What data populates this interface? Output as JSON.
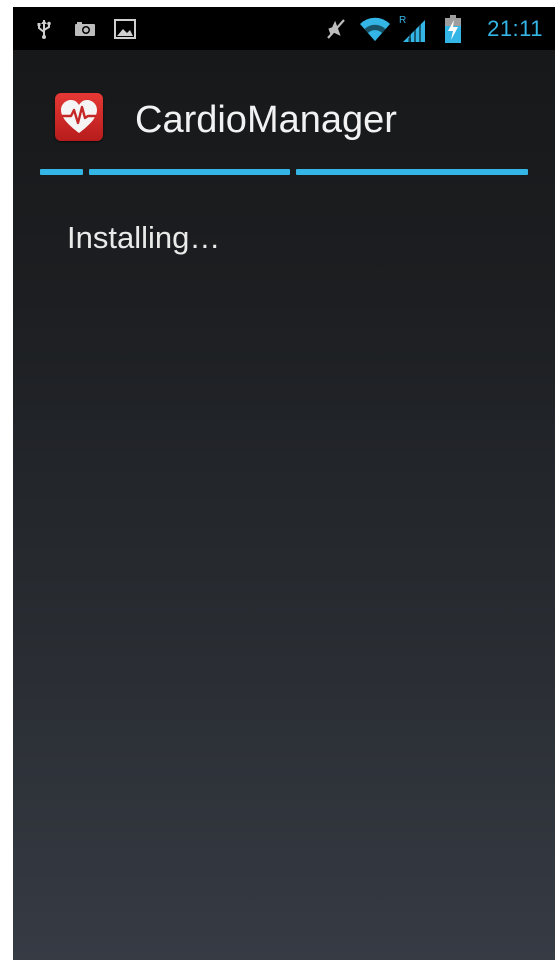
{
  "status_bar": {
    "left_icons": [
      "usb-icon",
      "camera-icon",
      "image-icon"
    ],
    "right_icons": [
      "mute-icon",
      "wifi-icon",
      "signal-roaming-icon",
      "battery-charging-icon"
    ],
    "roaming_mark": "R",
    "time": "21:11",
    "accent_color": "#33b5e5"
  },
  "action_bar": {
    "app_icon": "heart-pulse-icon",
    "app_title": "CardioManager"
  },
  "progress": {
    "style": "indeterminate",
    "color": "#33b5e5"
  },
  "main": {
    "status_text": "Installing…"
  }
}
